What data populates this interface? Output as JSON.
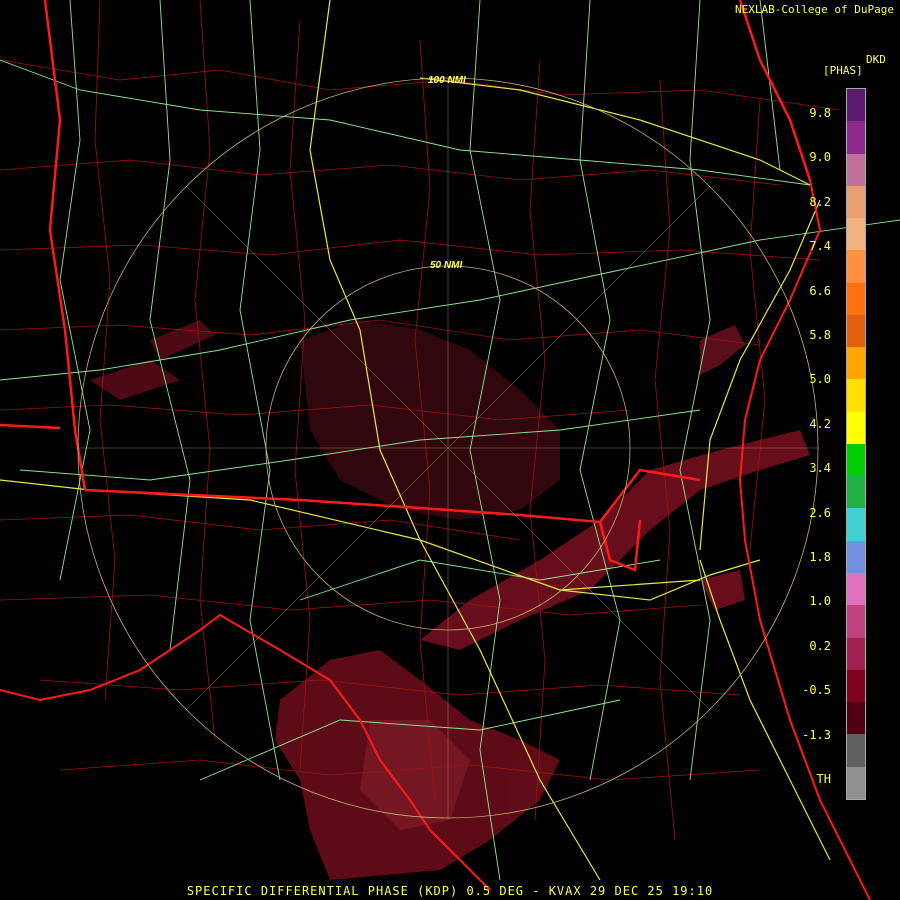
{
  "credit": "NEXLAB-College of DuPage",
  "legend": {
    "product_code": "DKD",
    "unit": "[PHAS]",
    "ticks": [
      "9.8",
      "9.0",
      "8.2",
      "7.4",
      "6.6",
      "5.8",
      "5.0",
      "4.2",
      "3.4",
      "2.6",
      "1.8",
      "1.0",
      "0.2",
      "-0.5",
      "-1.3",
      "TH"
    ],
    "colors": [
      "#5a1a6e",
      "#8e2a8e",
      "#c0709a",
      "#e8a070",
      "#f0b080",
      "#ff9040",
      "#ff7010",
      "#e06010",
      "#ffa500",
      "#ffe000",
      "#ffff00",
      "#00cc00",
      "#20b040",
      "#40d0d0",
      "#7090e0",
      "#e070c0",
      "#c04080",
      "#a02050",
      "#800020",
      "#500010",
      "#606060",
      "#909090"
    ]
  },
  "rings": {
    "inner_label": "50 NMI",
    "outer_label": "100 NMI"
  },
  "footer": "SPECIFIC DIFFERENTIAL PHASE (KDP) 0.5 DEG - KVAX 29 DEC 25 19:10"
}
